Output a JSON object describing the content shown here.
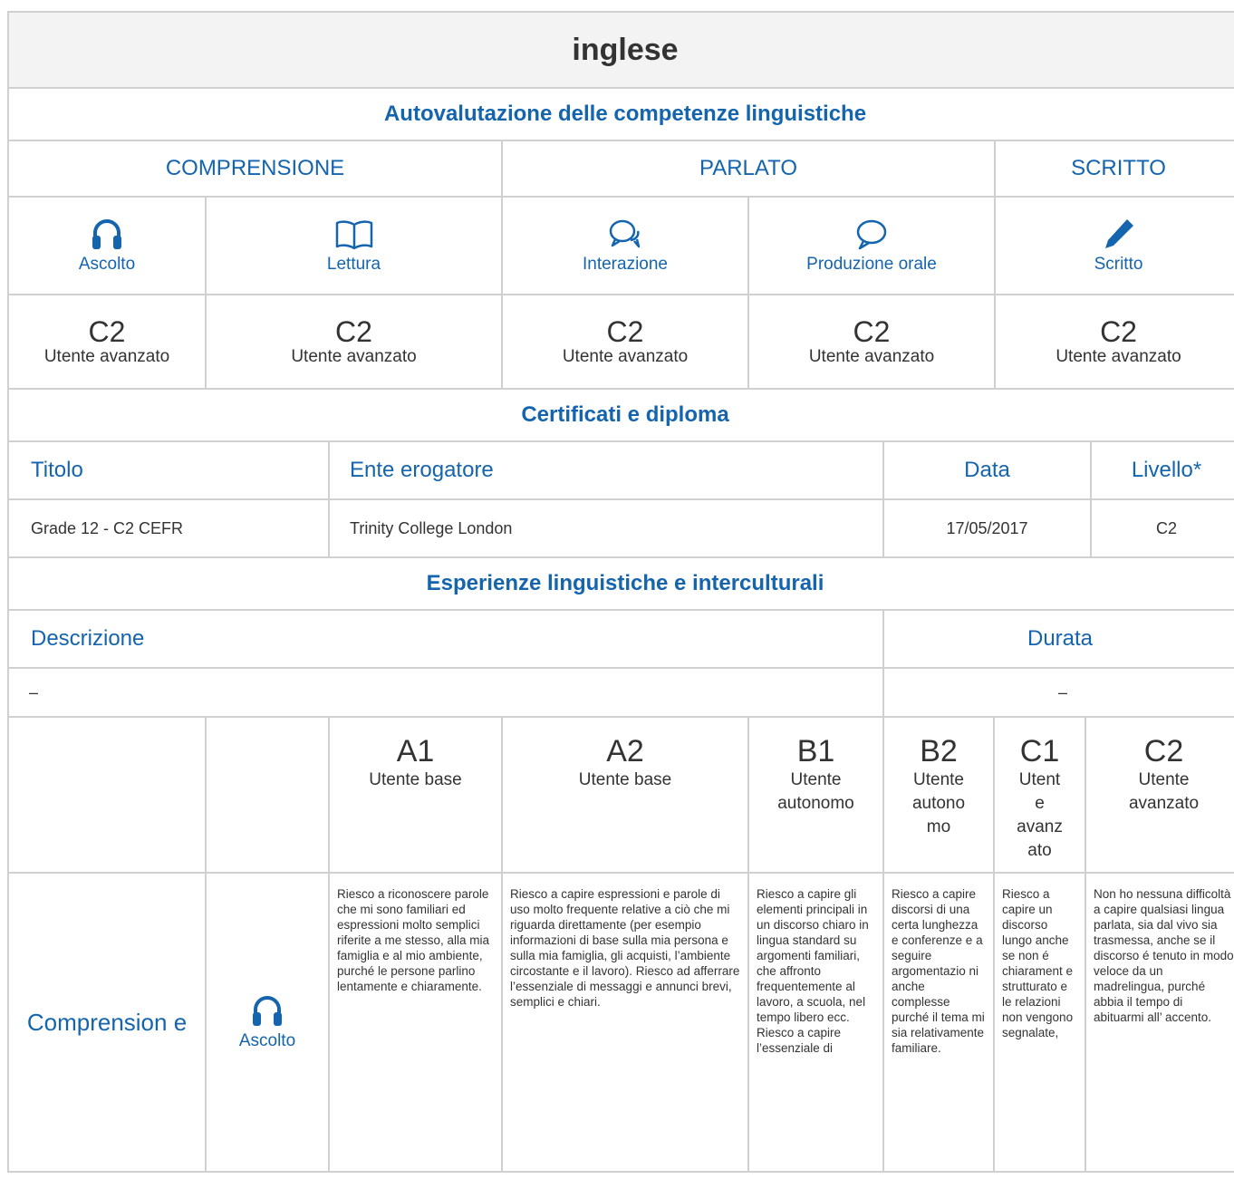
{
  "language": "inglese",
  "self_assessment": {
    "heading": "Autovalutazione delle competenze linguistiche",
    "groups": [
      "COMPRENSIONE",
      "PARLATO",
      "SCRITTO"
    ],
    "skills": [
      {
        "label": "Ascolto",
        "icon": "headphones-icon",
        "level": "C2",
        "level_text": "Utente avanzato"
      },
      {
        "label": "Lettura",
        "icon": "book-icon",
        "level": "C2",
        "level_text": "Utente avanzato"
      },
      {
        "label": "Interazione",
        "icon": "chat-bubbles-icon",
        "level": "C2",
        "level_text": "Utente avanzato"
      },
      {
        "label": "Produzione orale",
        "icon": "speech-bubble-icon",
        "level": "C2",
        "level_text": "Utente avanzato"
      },
      {
        "label": "Scritto",
        "icon": "pencil-icon",
        "level": "C2",
        "level_text": "Utente avanzato"
      }
    ]
  },
  "certificates": {
    "heading": "Certificati e diploma",
    "columns": [
      "Titolo",
      "Ente erogatore",
      "Data",
      "Livello*"
    ],
    "rows": [
      {
        "title": "Grade 12 - C2 CEFR",
        "issuer": "Trinity College London",
        "date": "17/05/2017",
        "level": "C2"
      }
    ]
  },
  "experiences": {
    "heading": "Esperienze linguistiche e interculturali",
    "columns": [
      "Descrizione",
      "Durata"
    ],
    "rows": [
      {
        "description": "–",
        "duration": "–"
      }
    ]
  },
  "grid": {
    "levels": [
      {
        "code": "A1",
        "label": "Utente base"
      },
      {
        "code": "A2",
        "label": "Utente base"
      },
      {
        "code": "B1",
        "label": "Utente autonomo"
      },
      {
        "code": "B2",
        "label": "Utente autono mo"
      },
      {
        "code": "C1",
        "label": "Utent e avanz ato"
      },
      {
        "code": "C2",
        "label": "Utente avanzato"
      }
    ],
    "category": "Comprension e",
    "skill": "Ascolto",
    "descriptors": [
      "Riesco a riconoscere parole che mi sono familiari ed espressioni molto semplici riferite a me stesso, alla mia famiglia e al mio ambiente, purché le persone parlino lentamente e chiaramente.",
      "Riesco a capire espressioni e parole di uso molto frequente relative a ciò che mi riguarda direttamente (per esempio informazioni di base sulla mia persona e sulla mia famiglia, gli acquisti, l’ambiente circostante e il lavoro). Riesco ad afferrare l’essenziale di messaggi e annunci brevi, semplici e chiari.",
      "Riesco a capire gli elementi principali in un discorso chiaro in lingua standard su argomenti familiari, che affronto frequentemente al lavoro, a scuola, nel tempo libero ecc. Riesco a capire l’essenziale di",
      "Riesco a capire discorsi di una certa lunghezza e conferenze e a seguire argomentazio ni anche complesse purché il tema mi sia relativamente familiare.",
      "Riesco a capire un discorso lungo anche se non é chiarament e strutturato e le relazioni non vengono segnalate,",
      "Non ho nessuna difficoltà a capire qualsiasi lingua parlata, sia dal vivo sia trasmessa, anche se il discorso é tenuto in modo veloce da un madrelingua, purché abbia il tempo di abituarmi all’ accento."
    ]
  },
  "colors": {
    "accent": "#1464ae",
    "border": "#d0d0d0",
    "title_bg": "#f3f3f3",
    "text": "#333333"
  }
}
